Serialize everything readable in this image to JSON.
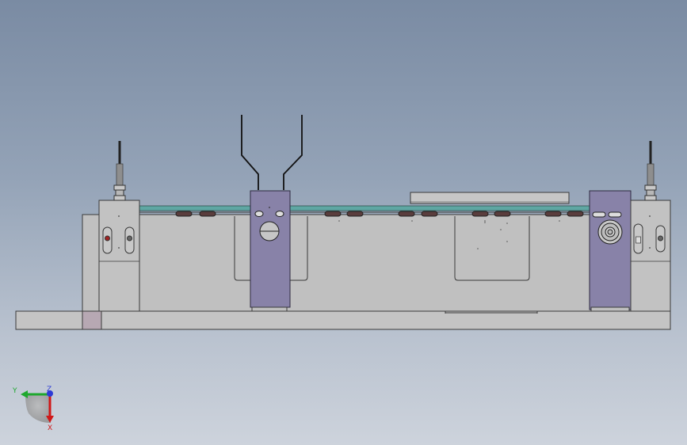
{
  "view": {
    "background_top": "#7a8ba3",
    "background_bottom": "#cdd3dc"
  },
  "model_colors": {
    "body": "#c0c0c0",
    "body_stroke": "#3a3a3a",
    "clamp_blocks": "#8882a8",
    "cover_strip": "#5fa7a3",
    "rollers": "#5a3d3d"
  },
  "triad": {
    "y_label": "Y",
    "z_label": "Z",
    "x_label": "X",
    "y_color": "#1fa82e",
    "z_color": "#2e3bd6",
    "x_color": "#d01818"
  }
}
